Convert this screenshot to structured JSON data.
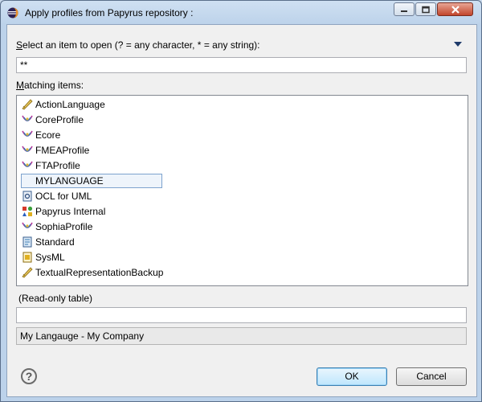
{
  "window": {
    "title": "Apply profiles from Papyrus repository :"
  },
  "filter": {
    "label": "Select an item to open (? = any character, * = any string):",
    "label_u": "S",
    "label_rest": "elect an item to open (? = any character, * = any string):",
    "value": "**"
  },
  "matching": {
    "label_u": "M",
    "label_rest": "atching items:"
  },
  "items": [
    {
      "label": "ActionLanguage",
      "icon": "pencil-diamond-icon"
    },
    {
      "label": "CoreProfile",
      "icon": "profile-icon"
    },
    {
      "label": "Ecore",
      "icon": "profile-icon"
    },
    {
      "label": "FMEAProfile",
      "icon": "profile-icon"
    },
    {
      "label": "FTAProfile",
      "icon": "profile-icon"
    },
    {
      "label": "MYLANGUAGE",
      "icon": "none",
      "selected": true
    },
    {
      "label": "OCL for UML",
      "icon": "document-icon"
    },
    {
      "label": "Papyrus Internal",
      "icon": "shapes-icon"
    },
    {
      "label": "SophiaProfile",
      "icon": "profile-icon"
    },
    {
      "label": "Standard",
      "icon": "standard-icon"
    },
    {
      "label": "SysML",
      "icon": "sysml-icon"
    },
    {
      "label": "TextualRepresentationBackup",
      "icon": "pencil-diamond-icon"
    }
  ],
  "readonly": {
    "label": "(Read-only table)",
    "value": ""
  },
  "status": {
    "text": "My Langauge - My Company"
  },
  "buttons": {
    "ok": "OK",
    "cancel": "Cancel"
  },
  "help": {
    "glyph": "?"
  }
}
